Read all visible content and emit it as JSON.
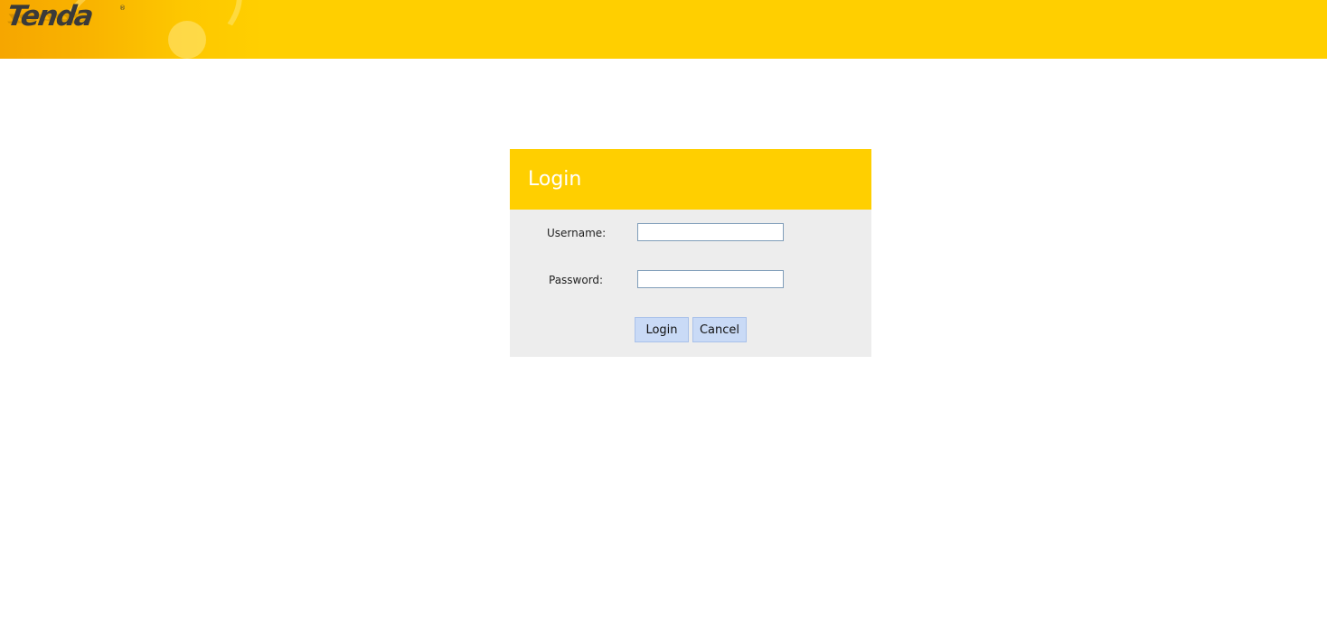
{
  "brand": {
    "logo_text": "Tenda",
    "registered_mark": "®",
    "primary_color": "#ffcf00",
    "panel_color": "#ededed",
    "button_color": "#c9daf6"
  },
  "login": {
    "title": "Login",
    "username_label": "Username:",
    "username_value": "",
    "password_label": "Password:",
    "password_value": "",
    "login_button": "Login",
    "cancel_button": "Cancel"
  }
}
